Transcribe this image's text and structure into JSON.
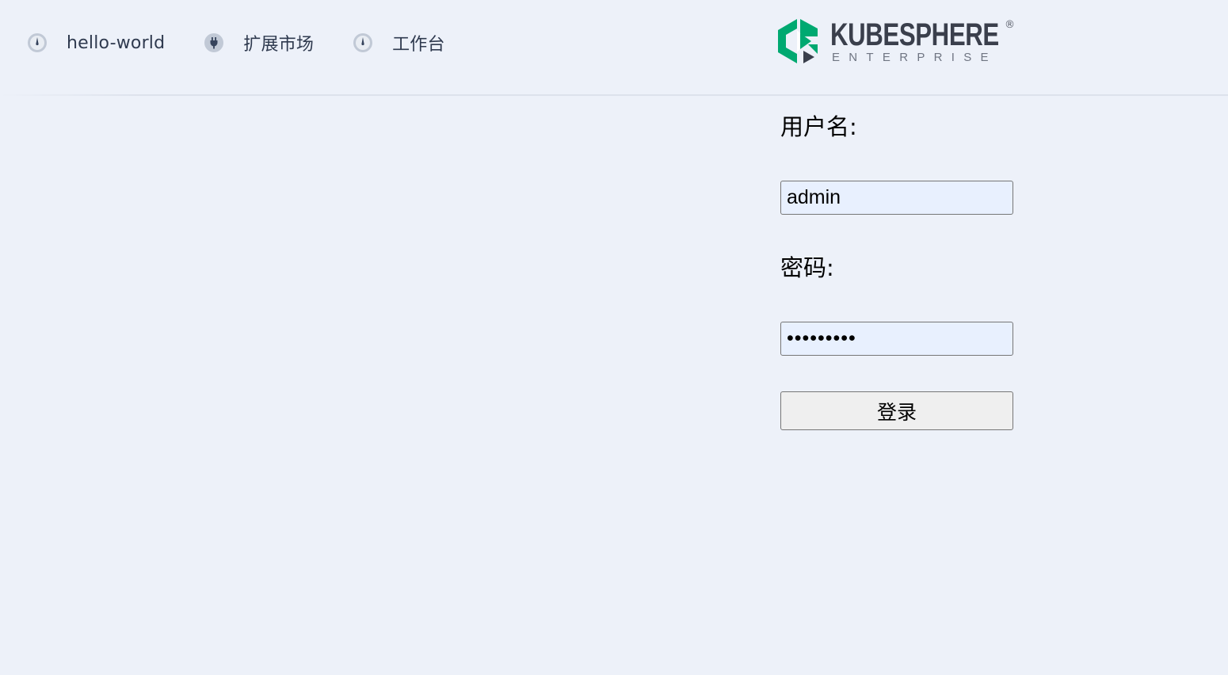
{
  "nav": {
    "items": [
      {
        "label": "hello-world",
        "icon": "clock-icon"
      },
      {
        "label": "扩展市场",
        "icon": "plug-icon"
      },
      {
        "label": "工作台",
        "icon": "clock-icon"
      }
    ]
  },
  "logo": {
    "name": "KUBESPHERE",
    "registered": "®",
    "edition": "ENTERPRISE",
    "colors": {
      "green": "#00a971",
      "dark": "#3a3f4c"
    }
  },
  "form": {
    "username_label": "用户名:",
    "username_value": "admin",
    "password_label": "密码:",
    "password_value": "•••••••••",
    "login_label": "登录"
  },
  "colors": {
    "background": "#edf1f9",
    "input_background": "#e8f0fe",
    "button_background": "#efefef"
  }
}
